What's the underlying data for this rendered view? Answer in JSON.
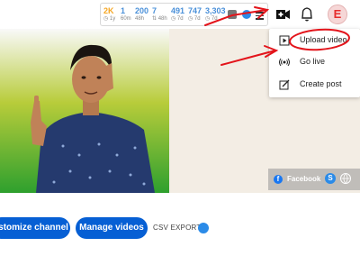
{
  "stats": [
    {
      "value": "2K",
      "label": "1y"
    },
    {
      "value": "1",
      "label": "60m"
    },
    {
      "value": "200",
      "label": "48h"
    },
    {
      "value": "7",
      "label": "48h"
    },
    {
      "value": "491",
      "label": "7d"
    },
    {
      "value": "747",
      "label": "7d"
    },
    {
      "value": "3,303",
      "label": "7d"
    }
  ],
  "create_menu": {
    "items": [
      {
        "label": "Upload video",
        "icon": "play-square-icon"
      },
      {
        "label": "Go live",
        "icon": "broadcast-icon"
      },
      {
        "label": "Create post",
        "icon": "edit-icon"
      }
    ]
  },
  "social": {
    "facebook_label": "Facebook",
    "s_badge": "S"
  },
  "avatar_letter": "E",
  "actions": {
    "customize_label": "ustomize channel",
    "manage_label": "Manage videos",
    "csv_label": "CSV EXPORT"
  },
  "colors": {
    "accent_blue": "#065fd4",
    "annotation_red": "#e3141b",
    "stat_blue": "#4a90d9",
    "stat_orange": "#f5a623"
  }
}
